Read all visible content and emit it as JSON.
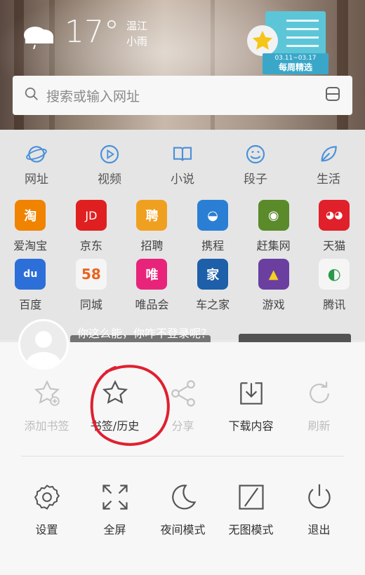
{
  "weather": {
    "temperature": "17°",
    "location": "温江",
    "condition": "小雨",
    "icon": "cloud-rain-icon"
  },
  "weekly": {
    "date_range": "03.11~03.17",
    "title": "每周精选"
  },
  "search": {
    "placeholder": "搜索或输入网址",
    "scan_icon": "scan-icon"
  },
  "tabs": [
    {
      "label": "网址",
      "icon": "globe-icon"
    },
    {
      "label": "视频",
      "icon": "play-icon"
    },
    {
      "label": "小说",
      "icon": "book-icon"
    },
    {
      "label": "段子",
      "icon": "smile-icon"
    },
    {
      "label": "生活",
      "icon": "leaf-icon"
    }
  ],
  "apps": [
    [
      {
        "label": "爱淘宝",
        "glyph": "淘",
        "color": "#f08300"
      },
      {
        "label": "京东",
        "glyph": "JD",
        "color": "#e02020"
      },
      {
        "label": "招聘",
        "glyph": "聘",
        "color": "#f0a020"
      },
      {
        "label": "携程",
        "glyph": "◒",
        "color": "#2a7fd4"
      },
      {
        "label": "赶集网",
        "glyph": "◉",
        "color": "#5a8a2a"
      },
      {
        "label": "天猫",
        "glyph": "◕◕",
        "color": "#e0202a"
      }
    ],
    [
      {
        "label": "百度",
        "glyph": "du",
        "color": "#2d6fd8"
      },
      {
        "label": "同城",
        "glyph": "58",
        "color": "#f5f5f5"
      },
      {
        "label": "唯品会",
        "glyph": "唯",
        "color": "#e8247a"
      },
      {
        "label": "车之家",
        "glyph": "家",
        "color": "#1d5fa8"
      },
      {
        "label": "游戏",
        "glyph": "▲",
        "color": "#6a3fa0"
      },
      {
        "label": "腾讯",
        "glyph": "◐",
        "color": "#f5f5f5"
      }
    ]
  ],
  "login_prompt": "你这么能，你咋不登录呢？",
  "menu": {
    "row1": [
      {
        "label": "添加书签",
        "icon": "add-bookmark-icon",
        "enabled": false
      },
      {
        "label": "书签/历史",
        "icon": "star-icon",
        "enabled": true
      },
      {
        "label": "分享",
        "icon": "share-icon",
        "enabled": false
      },
      {
        "label": "下载内容",
        "icon": "download-icon",
        "enabled": true
      },
      {
        "label": "刷新",
        "icon": "refresh-icon",
        "enabled": false
      }
    ],
    "row2": [
      {
        "label": "设置",
        "icon": "gear-icon",
        "enabled": true
      },
      {
        "label": "全屏",
        "icon": "fullscreen-icon",
        "enabled": true
      },
      {
        "label": "夜间模式",
        "icon": "moon-icon",
        "enabled": true
      },
      {
        "label": "无图模式",
        "icon": "no-image-icon",
        "enabled": true
      },
      {
        "label": "退出",
        "icon": "power-icon",
        "enabled": true
      }
    ]
  },
  "annotation_color": "#e02030"
}
